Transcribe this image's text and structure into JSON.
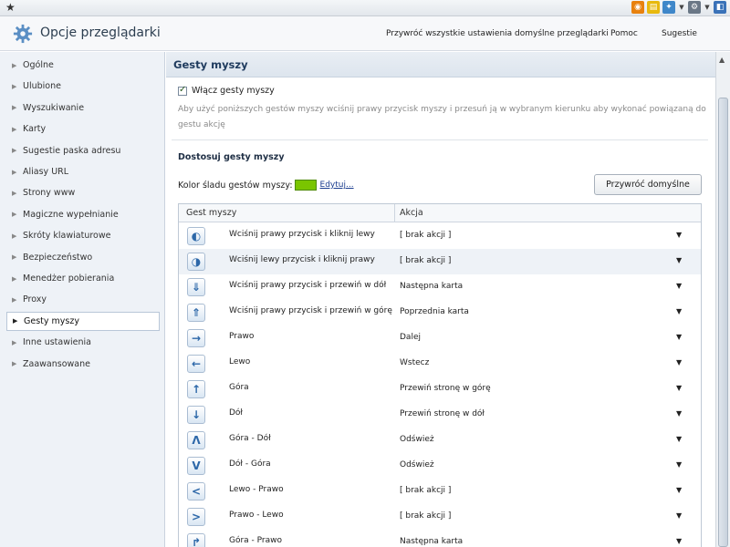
{
  "browser_bar": {
    "icons": [
      {
        "name": "rss-icon",
        "color": "#e8810e",
        "glyph": "◉"
      },
      {
        "name": "note-icon",
        "color": "#e8b90e",
        "glyph": "▤"
      },
      {
        "name": "extension-icon",
        "color": "#3f87c9",
        "glyph": "✦"
      },
      {
        "name": "settings-icon",
        "color": "#6a7786",
        "glyph": "⚙"
      },
      {
        "name": "book-icon",
        "color": "#3a72b8",
        "glyph": "◧"
      }
    ]
  },
  "header": {
    "title": "Opcje przeglądarki",
    "links": {
      "restore_all": "Przywróć wszystkie ustawienia domyślne przeglądarki",
      "help": "Pomoc",
      "suggestions": "Sugestie"
    }
  },
  "sidebar": {
    "items": [
      {
        "label": "Ogólne"
      },
      {
        "label": "Ulubione"
      },
      {
        "label": "Wyszukiwanie"
      },
      {
        "label": "Karty"
      },
      {
        "label": "Sugestie paska adresu"
      },
      {
        "label": "Aliasy URL"
      },
      {
        "label": "Strony www"
      },
      {
        "label": "Magiczne wypełnianie"
      },
      {
        "label": "Skróty klawiaturowe"
      },
      {
        "label": "Bezpieczeństwo"
      },
      {
        "label": "Menedżer pobierania"
      },
      {
        "label": "Proxy"
      },
      {
        "label": "Gesty myszy",
        "active": true
      },
      {
        "label": "Inne ustawienia"
      },
      {
        "label": "Zaawansowane"
      }
    ]
  },
  "main": {
    "section_title": "Gesty myszy",
    "enable_label": "Włącz gesty myszy",
    "enable_checked": true,
    "description": "Aby użyć poniższych gestów myszy wciśnij prawy przycisk myszy i przesuń ją w wybranym kierunku aby wykonać powiązaną do gestu akcję",
    "customize_title": "Dostosuj gesty myszy",
    "color_label": "Kolor śladu gestów myszy:",
    "trail_color": "#7ac500",
    "edit_link": "Edytuj...",
    "restore_button": "Przywróć domyślne",
    "table": {
      "col_gesture": "Gest myszy",
      "col_action": "Akcja",
      "rows": [
        {
          "icon": "mouse-right-left-icon",
          "glyph": "◐",
          "gesture": "Wciśnij prawy przycisk i kliknij lewy",
          "action": "[ brak akcji ]"
        },
        {
          "icon": "mouse-left-right-icon",
          "glyph": "◑",
          "gesture": "Wciśnij lewy przycisk i kliknij prawy",
          "action": "[ brak akcji ]"
        },
        {
          "icon": "mouse-wheel-down-icon",
          "glyph": "⇓",
          "gesture": "Wciśnij prawy przycisk i przewiń w dół",
          "action": "Następna karta"
        },
        {
          "icon": "mouse-wheel-up-icon",
          "glyph": "⇑",
          "gesture": "Wciśnij prawy przycisk i przewiń w górę",
          "action": "Poprzednia karta"
        },
        {
          "icon": "arrow-right-icon",
          "glyph": "→",
          "gesture": "Prawo",
          "action": "Dalej"
        },
        {
          "icon": "arrow-left-icon",
          "glyph": "←",
          "gesture": "Lewo",
          "action": "Wstecz"
        },
        {
          "icon": "arrow-up-icon",
          "glyph": "↑",
          "gesture": "Góra",
          "action": "Przewiń stronę w górę"
        },
        {
          "icon": "arrow-down-icon",
          "glyph": "↓",
          "gesture": "Dół",
          "action": "Przewiń stronę w dół"
        },
        {
          "icon": "gesture-up-down-icon",
          "glyph": "Λ",
          "gesture": "Góra - Dół",
          "action": "Odśwież"
        },
        {
          "icon": "gesture-down-up-icon",
          "glyph": "V",
          "gesture": "Dół - Góra",
          "action": "Odśwież"
        },
        {
          "icon": "gesture-left-right-icon",
          "glyph": "<",
          "gesture": "Lewo - Prawo",
          "action": "[ brak akcji ]"
        },
        {
          "icon": "gesture-right-left-icon",
          "glyph": ">",
          "gesture": "Prawo - Lewo",
          "action": "[ brak akcji ]"
        },
        {
          "icon": "gesture-up-right-icon",
          "glyph": "↱",
          "gesture": "Góra - Prawo",
          "action": "Następna karta"
        }
      ]
    }
  }
}
